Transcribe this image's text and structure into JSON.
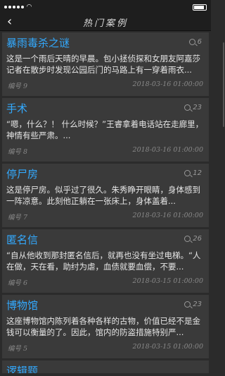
{
  "status": {
    "time": "",
    "carrier": ""
  },
  "nav": {
    "back_glyph": "‹",
    "title": "热门案例"
  },
  "cases": [
    {
      "title": "暴雨毒杀之谜",
      "views": "6",
      "summary": "这是一个雨后天晴的早晨。包小拯侦探和女朋友阿嘉莎记者在散步时发现公园后门的马路上有一穿着雨衣...",
      "number": "编号 9",
      "time": "2018-03-16 01:00:00"
    },
    {
      "title": "手术",
      "views": "23",
      "summary": "“嗯，什么？！ 什么时候？”王睿拿着电话站在走廊里，神情有些严肃。...",
      "number": "编号 8",
      "time": "2018-03-16 01:00:00"
    },
    {
      "title": "停尸房",
      "views": "12",
      "summary": "这是停尸房。似乎过了很久。朱秀睁开眼睛，身体感到一阵凉意。此刻他正躺在一张床上，身体盖着...",
      "number": "编号 7",
      "time": "2018-03-16 01:00:00"
    },
    {
      "title": "匿名信",
      "views": "26",
      "summary": "“自从他收到那封匿名信后，就再也没有坐过电梯。“人在做，天在看，助纣为虐，血债就要血偿，不要...",
      "number": "编号 6",
      "time": "2018-03-15 01:00:00"
    },
    {
      "title": "博物馆",
      "views": "23",
      "summary": "这座博物馆内陈列着各种各样的古物，价值已经不是金钱可以衡量的了。因此，馆内的防盗措施特别严...",
      "number": "编号 5",
      "time": "2018-03-15 01:00:00"
    },
    {
      "title": "逻辑题",
      "views": "",
      "summary": "",
      "number": "",
      "time": ""
    }
  ]
}
